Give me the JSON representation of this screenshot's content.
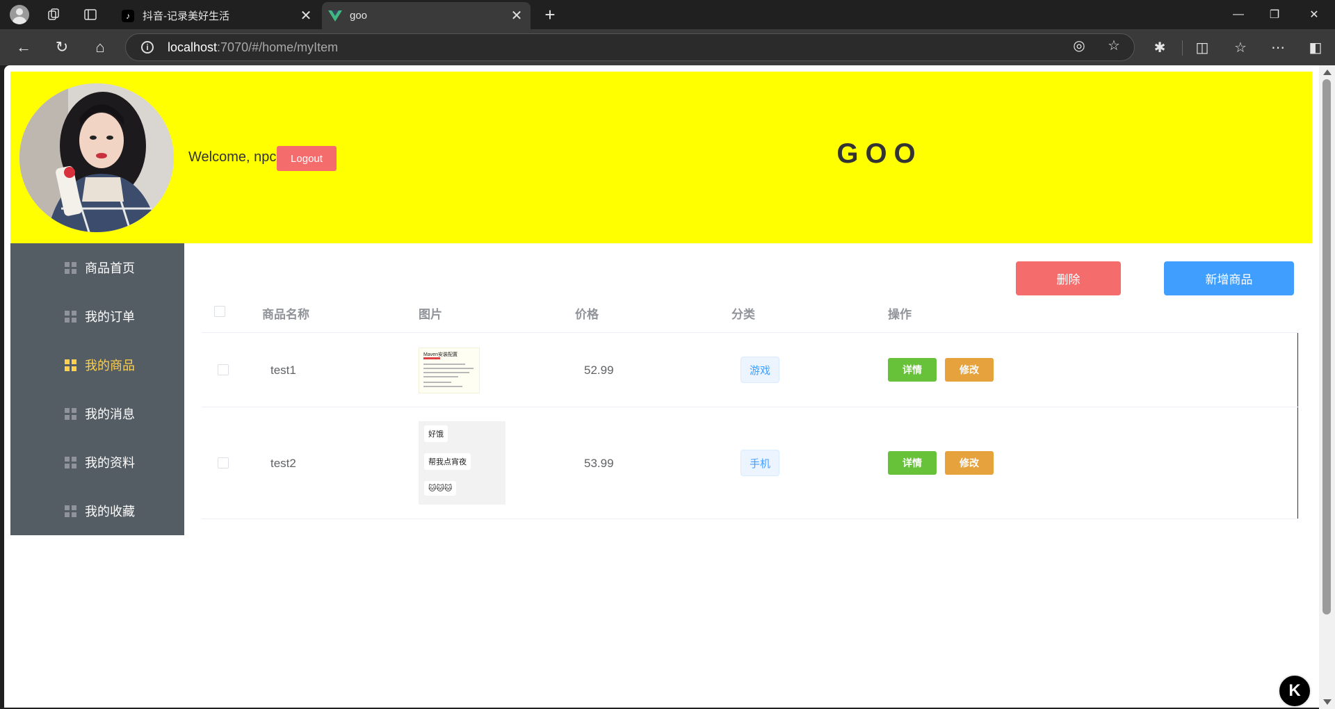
{
  "browser": {
    "tabs": [
      {
        "title": "抖音-记录美好生活",
        "favicon": "tiktok-icon"
      },
      {
        "title": "goo",
        "favicon": "vue-icon"
      }
    ],
    "url_host": "localhost",
    "url_rest": ":7070/#/home/myItem"
  },
  "header": {
    "welcome": "Welcome, npc",
    "logout_label": "Logout",
    "app_title": "GOO"
  },
  "sidebar": {
    "items": [
      {
        "label": "商品首页"
      },
      {
        "label": "我的订单"
      },
      {
        "label": "我的商品"
      },
      {
        "label": "我的消息"
      },
      {
        "label": "我的资料"
      },
      {
        "label": "我的收藏"
      }
    ],
    "active_index": 2
  },
  "toolbar": {
    "delete_label": "删除",
    "add_label": "新增商品"
  },
  "table": {
    "columns": [
      "商品名称",
      "图片",
      "价格",
      "分类",
      "操作"
    ],
    "rows": [
      {
        "name": "test1",
        "price": "52.99",
        "category": "游戏",
        "detail": "详情",
        "edit": "修改",
        "thumb_title": "Maven安装配置"
      },
      {
        "name": "test2",
        "price": "53.99",
        "category": "手机",
        "detail": "详情",
        "edit": "修改",
        "bubbles": [
          "好饿",
          "帮我点宵夜",
          "🐱🐱🐱"
        ]
      }
    ]
  },
  "colors": {
    "header_bg": "#ffff00",
    "sidebar_bg": "#545c64",
    "active_menu": "#ffd04b",
    "danger": "#f56c6c",
    "primary": "#409eff",
    "success": "#67c23a",
    "warning": "#e6a23c"
  }
}
